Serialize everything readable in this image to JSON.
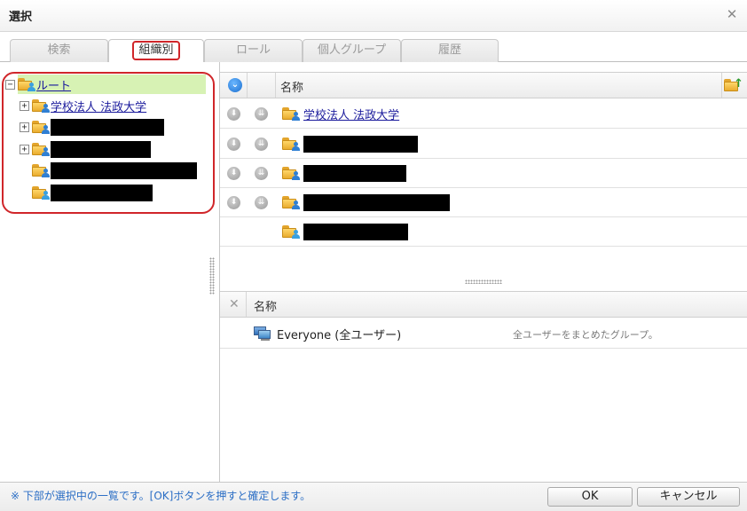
{
  "dialog": {
    "title": "選択"
  },
  "tabs": [
    {
      "label": "検索"
    },
    {
      "label": "組織別",
      "active": true
    },
    {
      "label": "ロール"
    },
    {
      "label": "個人グループ"
    },
    {
      "label": "履歴"
    }
  ],
  "tree": {
    "root_label": "ルート",
    "items": [
      {
        "label": "学校法人 法政大学",
        "expandable": true,
        "redacted": false
      },
      {
        "label": "",
        "expandable": true,
        "redacted": true
      },
      {
        "label": "",
        "expandable": true,
        "redacted": true
      },
      {
        "label": "",
        "expandable": false,
        "redacted": true
      },
      {
        "label": "",
        "expandable": false,
        "redacted": true,
        "group": true
      }
    ]
  },
  "org_grid": {
    "header": "名称",
    "rows": [
      {
        "label": "学校法人 法政大学",
        "redacted": false
      },
      {
        "label": "",
        "redacted": true
      },
      {
        "label": "",
        "redacted": true
      },
      {
        "label": "",
        "redacted": true
      },
      {
        "label": "",
        "redacted": true
      }
    ]
  },
  "selected_grid": {
    "header": "名称",
    "rows": [
      {
        "name": "Everyone (全ユーザー)",
        "description": "全ユーザーをまとめたグループ。"
      }
    ]
  },
  "footer": {
    "note": "※ 下部が選択中の一覧です。[OK]ボタンを押すと確定します。",
    "ok_label": "OK",
    "cancel_label": "キャンセル"
  },
  "colors": {
    "highlight_red": "#d0262a",
    "root_bg": "#d7f2b4",
    "link": "#1a1a9c",
    "note_blue": "#2b6ec5"
  }
}
